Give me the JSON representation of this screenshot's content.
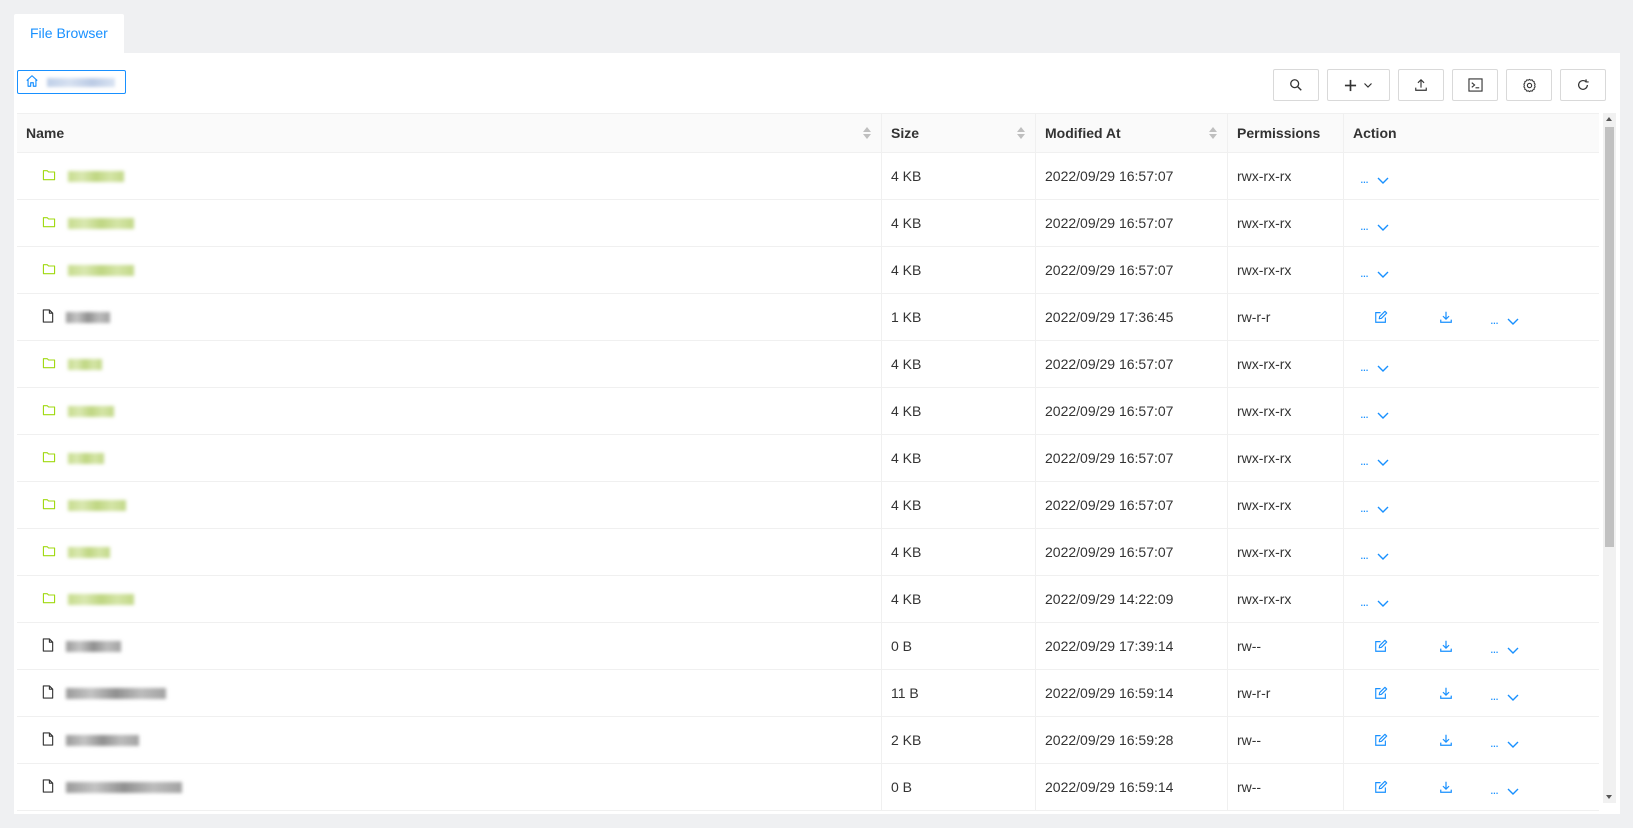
{
  "tabs": [
    {
      "label": "File Browser",
      "active": true
    }
  ],
  "breadcrumb": {
    "icon": "home-icon"
  },
  "toolbar": {
    "buttons": [
      {
        "name": "search-button",
        "icon": "search-icon"
      },
      {
        "name": "new-button",
        "icon": "plus-icon"
      },
      {
        "name": "upload-button",
        "icon": "upload-icon"
      },
      {
        "name": "terminal-button",
        "icon": "terminal-icon"
      },
      {
        "name": "settings-button",
        "icon": "gear-icon"
      },
      {
        "name": "refresh-button",
        "icon": "refresh-icon"
      }
    ]
  },
  "table": {
    "columns": {
      "name": "Name",
      "size": "Size",
      "modified": "Modified At",
      "permissions": "Permissions",
      "action": "Action"
    },
    "rows": [
      {
        "type": "folder",
        "size": "4 KB",
        "modified": "2022/09/29 16:57:07",
        "permissions": "rwx-rx-rx"
      },
      {
        "type": "folder",
        "size": "4 KB",
        "modified": "2022/09/29 16:57:07",
        "permissions": "rwx-rx-rx"
      },
      {
        "type": "folder",
        "size": "4 KB",
        "modified": "2022/09/29 16:57:07",
        "permissions": "rwx-rx-rx"
      },
      {
        "type": "file",
        "size": "1 KB",
        "modified": "2022/09/29 17:36:45",
        "permissions": "rw-r-r"
      },
      {
        "type": "folder",
        "size": "4 KB",
        "modified": "2022/09/29 16:57:07",
        "permissions": "rwx-rx-rx"
      },
      {
        "type": "folder",
        "size": "4 KB",
        "modified": "2022/09/29 16:57:07",
        "permissions": "rwx-rx-rx"
      },
      {
        "type": "folder",
        "size": "4 KB",
        "modified": "2022/09/29 16:57:07",
        "permissions": "rwx-rx-rx"
      },
      {
        "type": "folder",
        "size": "4 KB",
        "modified": "2022/09/29 16:57:07",
        "permissions": "rwx-rx-rx"
      },
      {
        "type": "folder",
        "size": "4 KB",
        "modified": "2022/09/29 16:57:07",
        "permissions": "rwx-rx-rx"
      },
      {
        "type": "folder",
        "size": "4 KB",
        "modified": "2022/09/29 14:22:09",
        "permissions": "rwx-rx-rx"
      },
      {
        "type": "file",
        "size": "0 B",
        "modified": "2022/09/29 17:39:14",
        "permissions": "rw--"
      },
      {
        "type": "file",
        "size": "11 B",
        "modified": "2022/09/29 16:59:14",
        "permissions": "rw-r-r"
      },
      {
        "type": "file",
        "size": "2 KB",
        "modified": "2022/09/29 16:59:28",
        "permissions": "rw--"
      },
      {
        "type": "file",
        "size": "0 B",
        "modified": "2022/09/29 16:59:14",
        "permissions": "rw--"
      }
    ]
  },
  "colors": {
    "accent": "#1890ff",
    "folder": "#a0d911",
    "background": "#eff0f2"
  }
}
